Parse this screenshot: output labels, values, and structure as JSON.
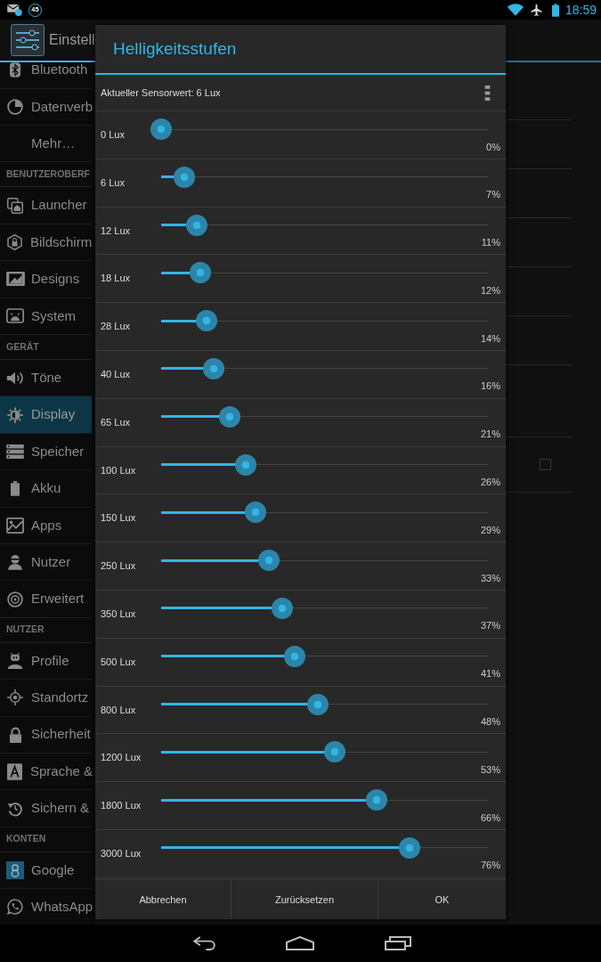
{
  "status_bar": {
    "notification_count": "45",
    "time": "18:59"
  },
  "action_bar": {
    "title": "Einstell"
  },
  "sidebar": {
    "sections": [
      {
        "items": [
          {
            "label": "Bluetooth",
            "selected": false
          },
          {
            "label": "Datenverb",
            "selected": false
          },
          {
            "label": "Mehr…",
            "selected": false
          }
        ]
      },
      {
        "header": "BENUTZEROBERF",
        "items": [
          {
            "label": "Launcher",
            "selected": false
          },
          {
            "label": "Bildschirm",
            "selected": false
          },
          {
            "label": "Designs",
            "selected": false
          },
          {
            "label": "System",
            "selected": false
          }
        ]
      },
      {
        "header": "GERÄT",
        "items": [
          {
            "label": "Töne",
            "selected": false
          },
          {
            "label": "Display",
            "selected": true
          },
          {
            "label": "Speicher",
            "selected": false
          },
          {
            "label": "Akku",
            "selected": false
          },
          {
            "label": "Apps",
            "selected": false
          },
          {
            "label": "Nutzer",
            "selected": false
          },
          {
            "label": "Erweitert",
            "selected": false
          }
        ]
      },
      {
        "header": "NUTZER",
        "items": [
          {
            "label": "Profile",
            "selected": false
          },
          {
            "label": "Standortz",
            "selected": false
          },
          {
            "label": "Sicherheit",
            "selected": false
          },
          {
            "label": "Sprache &",
            "selected": false
          },
          {
            "label": "Sichern &",
            "selected": false
          }
        ]
      },
      {
        "header": "KONTEN",
        "items": [
          {
            "label": "Google",
            "selected": false
          },
          {
            "label": "WhatsApp",
            "selected": false
          }
        ]
      }
    ]
  },
  "detail_pane": {
    "checkbox": {
      "checked": false
    }
  },
  "dialog": {
    "title": "Helligkeitsstufen",
    "sensor_reading": "Aktueller Sensorwert: 6 Lux",
    "levels": [
      {
        "label": "0 Lux",
        "level": 0,
        "reading": "0%"
      },
      {
        "label": "6 Lux",
        "level": 0.07,
        "reading": "7%"
      },
      {
        "label": "12 Lux",
        "level": 0.11,
        "reading": "11%"
      },
      {
        "label": "18 Lux",
        "level": 0.12,
        "reading": "12%"
      },
      {
        "label": "28 Lux",
        "level": 0.14,
        "reading": "14%"
      },
      {
        "label": "40 Lux",
        "level": 0.16,
        "reading": "16%"
      },
      {
        "label": "65 Lux",
        "level": 0.21,
        "reading": "21%"
      },
      {
        "label": "100 Lux",
        "level": 0.26,
        "reading": "26%"
      },
      {
        "label": "150 Lux",
        "level": 0.29,
        "reading": "29%"
      },
      {
        "label": "250 Lux",
        "level": 0.33,
        "reading": "33%"
      },
      {
        "label": "350 Lux",
        "level": 0.37,
        "reading": "37%"
      },
      {
        "label": "500 Lux",
        "level": 0.41,
        "reading": "41%"
      },
      {
        "label": "800 Lux",
        "level": 0.48,
        "reading": "48%"
      },
      {
        "label": "1200 Lux",
        "level": 0.53,
        "reading": "53%"
      },
      {
        "label": "1800 Lux",
        "level": 0.66,
        "reading": "66%"
      },
      {
        "label": "3000 Lux",
        "level": 0.76,
        "reading": "76%"
      }
    ],
    "buttons": [
      "Abbrechen",
      "Zurücksetzen",
      "OK"
    ]
  }
}
